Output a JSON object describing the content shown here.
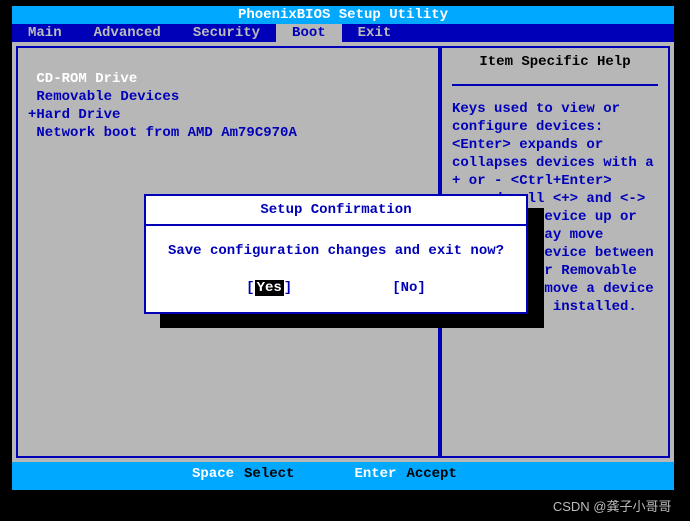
{
  "title": "PhoenixBIOS Setup Utility",
  "menu": {
    "items": [
      "Main",
      "Advanced",
      "Security",
      "Boot",
      "Exit"
    ],
    "active_index": 3
  },
  "boot_list": [
    {
      "label": " CD-ROM Drive",
      "hl": true
    },
    {
      "label": " Removable Devices",
      "hl": false
    },
    {
      "label": "+Hard Drive",
      "hl": false
    },
    {
      "label": " Network boot from AMD Am79C970A",
      "hl": false
    }
  ],
  "help": {
    "title": "Item Specific Help",
    "text": "Keys used to view or configure devices:\n<Enter> expands or collapses devices with a + or -\n<Ctrl+Enter> expands all\n<+> and <-> moves the device up or down.\n<n> May move removable device between Hard Disk or Removable Disk\n<d> Remove a device that is not installed."
  },
  "modal": {
    "title": "Setup Confirmation",
    "message": "Save configuration changes and exit now?",
    "yes": "Yes",
    "no": "No"
  },
  "footer": {
    "key1": "Space",
    "act1": "Select",
    "key2": "Enter",
    "act2": "Accept"
  },
  "watermark": "CSDN @龚子小哥哥 "
}
